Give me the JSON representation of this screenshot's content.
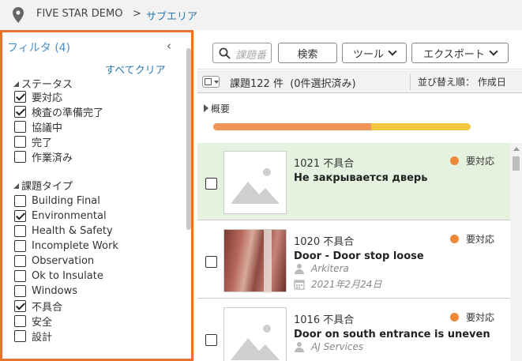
{
  "breadcrumb": {
    "root": "FIVE STAR DEMO",
    "separator": ">",
    "current": "サブエリア"
  },
  "filter": {
    "title": "フィルタ",
    "count": "(4)",
    "clear_all": "すべてクリア",
    "groups": [
      {
        "label": "ステータス",
        "options": [
          {
            "label": "要対応",
            "checked": true
          },
          {
            "label": "検査の準備完了",
            "checked": true
          },
          {
            "label": "協議中",
            "checked": false
          },
          {
            "label": "完了",
            "checked": false
          },
          {
            "label": "作業済み",
            "checked": false
          }
        ]
      },
      {
        "label": "課題タイプ",
        "options": [
          {
            "label": "Building Final",
            "checked": false
          },
          {
            "label": "Environmental",
            "checked": true
          },
          {
            "label": "Health & Safety",
            "checked": false
          },
          {
            "label": "Incomplete Work",
            "checked": false
          },
          {
            "label": "Observation",
            "checked": false
          },
          {
            "label": "Ok to Insulate",
            "checked": false
          },
          {
            "label": "Windows",
            "checked": false
          },
          {
            "label": "不具合",
            "checked": true
          },
          {
            "label": "安全",
            "checked": false
          },
          {
            "label": "設計",
            "checked": false
          }
        ]
      }
    ]
  },
  "toolbar": {
    "search_placeholder": "課題番",
    "search_button": "検索",
    "tools_button": "ツール",
    "export_button": "エクスポート"
  },
  "list": {
    "count_text": "課題122 件",
    "selected_text": "(0件選択済み)",
    "sort_text": "並び替え順： 作成日"
  },
  "overview": {
    "label": "概要",
    "progress_fraction": 0.615,
    "colors": {
      "primary": "#f0955a",
      "secondary": "#f5c640"
    }
  },
  "issues": [
    {
      "id_text": "1021 不具合",
      "title": "Не закрывается дверь",
      "status": "要対応",
      "company": "",
      "date": "",
      "selected": true,
      "image": "placeholder"
    },
    {
      "id_text": "1020 不具合",
      "title": "Door - Door stop loose",
      "status": "要対応",
      "company": "Arkitera",
      "date": "2021年2月24日",
      "selected": false,
      "image": "photo"
    },
    {
      "id_text": "1016 不具合",
      "title": "Door on south entrance is uneven",
      "status": "要対応",
      "company": "AJ Services",
      "date": "",
      "selected": false,
      "image": "placeholder"
    }
  ],
  "colors": {
    "accent": "#e8732a",
    "link": "#2a7ab0",
    "status_dot": "#f0883a",
    "selected_row": "#e4f2df"
  }
}
